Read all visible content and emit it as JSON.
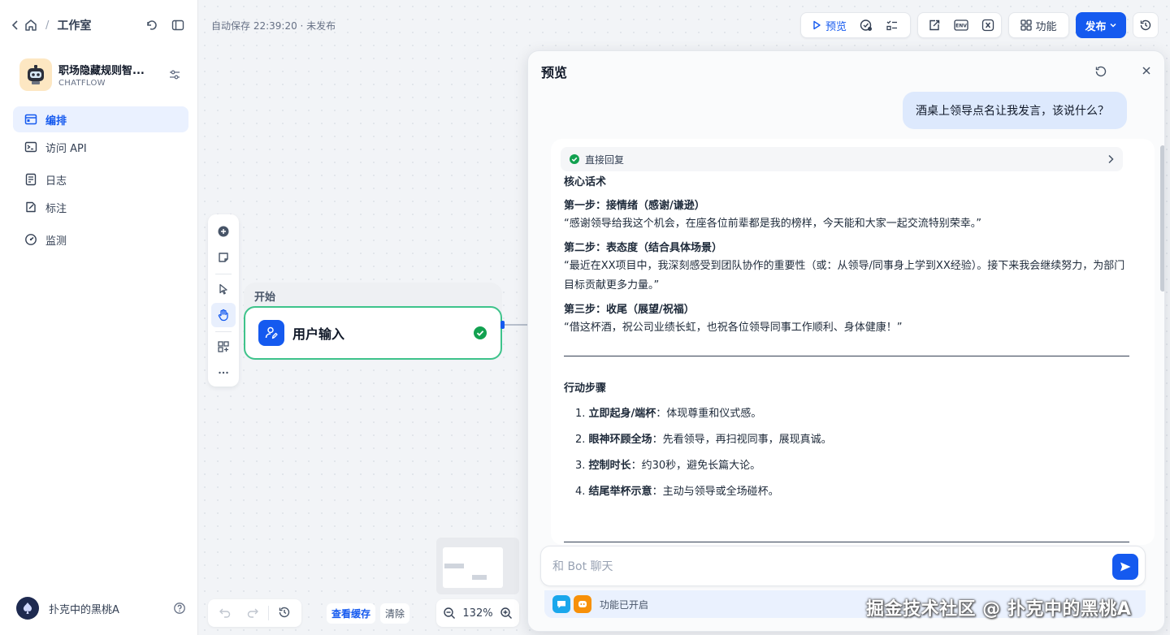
{
  "sidebar": {
    "breadcrumb_title": "工作室",
    "app": {
      "name": "职场隐藏规则智...",
      "type": "CHATFLOW"
    },
    "nav": [
      {
        "label": "编排",
        "icon": "layout-icon",
        "active": true
      },
      {
        "label": "访问 API",
        "icon": "terminal-icon",
        "active": false
      },
      {
        "label": "日志",
        "icon": "file-list-icon",
        "active": false
      },
      {
        "label": "标注",
        "icon": "annotation-icon",
        "active": false
      },
      {
        "label": "监测",
        "icon": "gauge-icon",
        "active": false
      }
    ],
    "user": {
      "name": "扑克中的黑桃A"
    }
  },
  "header": {
    "autosave": "自动保存 22:39:20 · 未发布",
    "preview_label": "预览",
    "features_label": "功能",
    "publish_label": "发布",
    "env_label": "ENV"
  },
  "canvas": {
    "node_group_label": "开始",
    "node_title": "用户输入",
    "view_cache": "查看缓存",
    "clear": "清除",
    "zoom": "132%"
  },
  "preview": {
    "title": "预览",
    "user_message": "酒桌上领导点名让我发言，该说什么？",
    "trace_label": "直接回复",
    "core_title": "核心话术",
    "steps": [
      {
        "title": "第一步：接情绪（感谢/谦逊）",
        "quote": "“感谢领导给我这个机会，在座各位前辈都是我的榜样，今天能和大家一起交流特别荣幸。”"
      },
      {
        "title": "第二步：表态度（结合具体场景）",
        "quote": "“最近在XX项目中，我深刻感受到团队协作的重要性（或：从领导/同事身上学到XX经验）。接下来我会继续努力，为部门目标贡献更多力量。”"
      },
      {
        "title": "第三步：收尾（展望/祝福）",
        "quote": "“借这杯酒，祝公司业绩长虹，也祝各位领导同事工作顺利、身体健康！”"
      }
    ],
    "actions_title": "行动步骤",
    "actions": [
      {
        "num": "1.",
        "bold": "立即起身/端杯",
        "rest": "：体现尊重和仪式感。"
      },
      {
        "num": "2.",
        "bold": "眼神环顾全场",
        "rest": "：先看领导，再扫视同事，展现真诚。"
      },
      {
        "num": "3.",
        "bold": "控制时长",
        "rest": "：约30秒，避免长篇大论。"
      },
      {
        "num": "4.",
        "bold": "结尾举杯示意",
        "rest": "：主动与领导或全场碰杯。"
      }
    ],
    "input_placeholder": "和 Bot 聊天",
    "features_enabled": "功能已开启"
  },
  "watermark": "掘金技术社区 @ 扑克中的黑桃A",
  "colors": {
    "accent": "#155aef",
    "success": "#3ec38b"
  }
}
